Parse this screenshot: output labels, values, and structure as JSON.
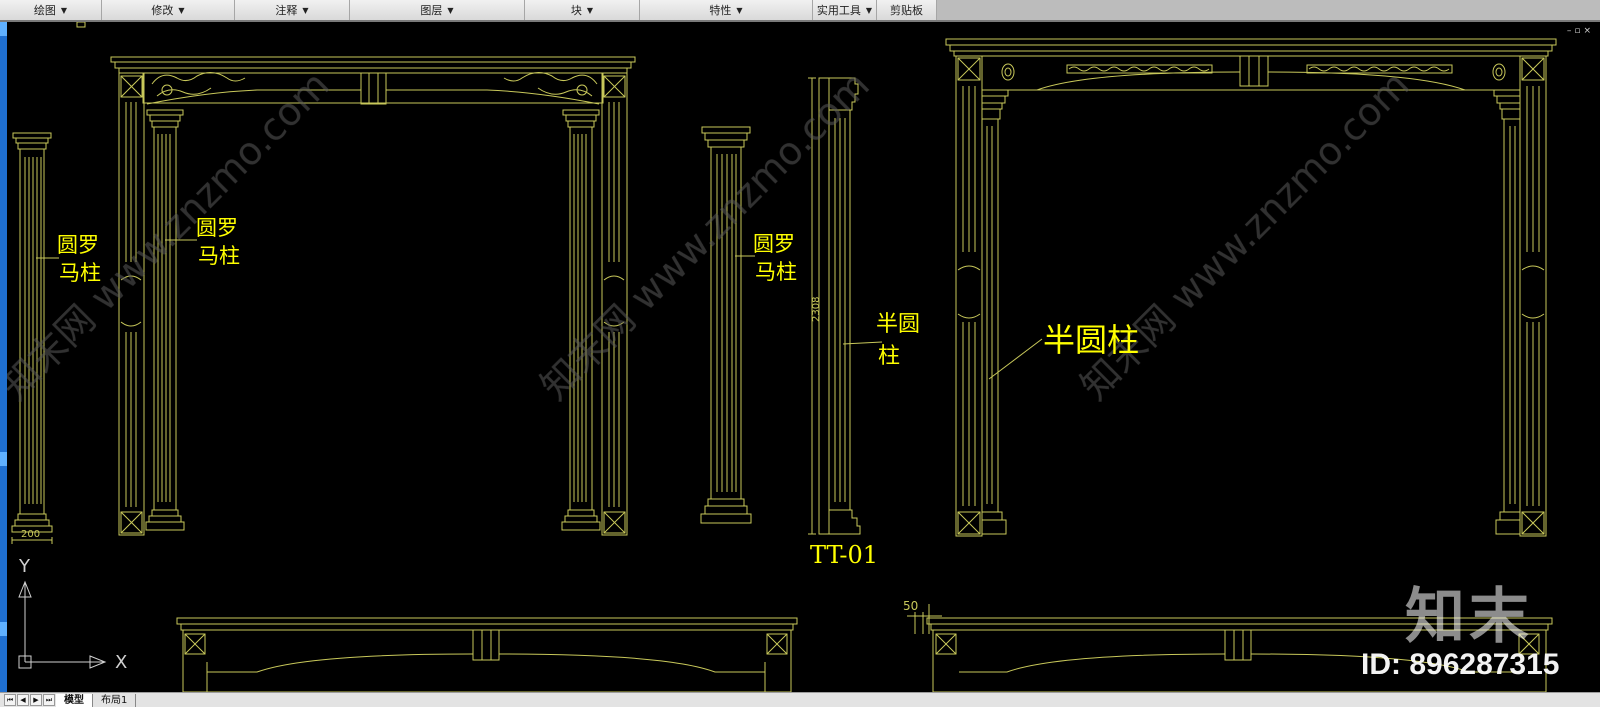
{
  "ribbon": {
    "panels": [
      {
        "label": "绘图",
        "dropdown": true
      },
      {
        "label": "修改",
        "dropdown": true
      },
      {
        "label": "注释",
        "dropdown": true
      },
      {
        "label": "图层",
        "dropdown": true
      },
      {
        "label": "块",
        "dropdown": true
      },
      {
        "label": "特性",
        "dropdown": true
      },
      {
        "label": "实用工具",
        "dropdown": true
      },
      {
        "label": "剪贴板",
        "dropdown": false
      }
    ]
  },
  "colors": {
    "background": "#000000",
    "lines": "#c8c85a",
    "text": "#ffff00",
    "ucs": "#d0d0d0"
  },
  "drawing": {
    "labels": {
      "roman_col_1": [
        "圆罗",
        "马柱"
      ],
      "roman_col_2": [
        "圆罗",
        "马柱"
      ],
      "roman_col_3": [
        "圆罗",
        "马柱"
      ],
      "half_col_1": [
        "半圆",
        "柱"
      ],
      "half_col_big": "半圆柱",
      "code": "TT-01",
      "dim_width": "200",
      "dim_height": "2308",
      "dim_small": "50"
    },
    "ucs": {
      "y": "Y",
      "x": "X"
    }
  },
  "watermark": {
    "logo": "知末",
    "id": "ID: 896287315",
    "diagonal": "知末网 www.znzmo.com"
  },
  "layout_tabs": [
    {
      "label": "模型",
      "active": true
    },
    {
      "label": "布局1",
      "active": false
    }
  ]
}
